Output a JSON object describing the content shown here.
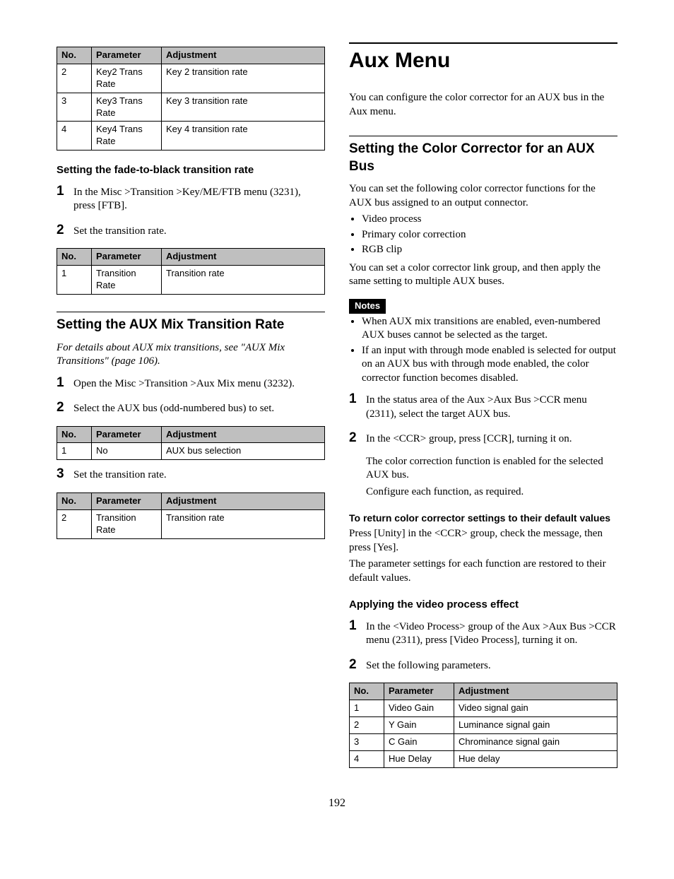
{
  "left": {
    "table1": {
      "headers": [
        "No.",
        "Parameter",
        "Adjustment"
      ],
      "rows": [
        {
          "no": "2",
          "param": "Key2 Trans Rate",
          "adj": "Key 2 transition rate"
        },
        {
          "no": "3",
          "param": "Key3 Trans Rate",
          "adj": "Key 3 transition rate"
        },
        {
          "no": "4",
          "param": "Key4 Trans Rate",
          "adj": "Key 4 transition rate"
        }
      ]
    },
    "h3_ftb": "Setting the fade-to-black transition rate",
    "ftb_step1": "In the Misc >Transition >Key/ME/FTB menu (3231), press [FTB].",
    "ftb_step2": "Set the transition rate.",
    "table2": {
      "headers": [
        "No.",
        "Parameter",
        "Adjustment"
      ],
      "rows": [
        {
          "no": "1",
          "param": "Transition Rate",
          "adj": "Transition rate"
        }
      ]
    },
    "h2_aux": "Setting the AUX Mix Transition Rate",
    "aux_note": "For details about AUX mix transitions, see \"AUX Mix Transitions\" (page 106).",
    "aux_step1": "Open the Misc >Transition >Aux Mix menu (3232).",
    "aux_step2": "Select the AUX bus (odd-numbered bus) to set.",
    "table3": {
      "headers": [
        "No.",
        "Parameter",
        "Adjustment"
      ],
      "rows": [
        {
          "no": "1",
          "param": "No",
          "adj": "AUX bus selection"
        }
      ]
    },
    "aux_step3": "Set the transition rate.",
    "table4": {
      "headers": [
        "No.",
        "Parameter",
        "Adjustment"
      ],
      "rows": [
        {
          "no": "2",
          "param": "Transition Rate",
          "adj": "Transition rate"
        }
      ]
    }
  },
  "right": {
    "h1": "Aux Menu",
    "intro": "You can configure the color corrector for an AUX bus in the Aux menu.",
    "h2_ccr": "Setting the Color Corrector for an AUX Bus",
    "ccr_intro": "You can set the following color corrector functions for the AUX bus assigned to an output connector.",
    "ccr_funcs": [
      "Video process",
      "Primary color correction",
      "RGB clip"
    ],
    "ccr_link": "You can set a color corrector link group, and then apply the same setting to multiple AUX buses.",
    "notes_label": "Notes",
    "notes": [
      "When AUX mix transitions are enabled, even-numbered AUX buses cannot be selected as the target.",
      "If an input with through mode enabled is selected for output on an AUX bus with through mode enabled, the color corrector function becomes disabled."
    ],
    "ccr_step1": "In the status area of the Aux >Aux Bus >CCR menu (2311), select the target AUX bus.",
    "ccr_step2": "In the <CCR> group, press [CCR], turning it on.",
    "ccr_step2a": "The color correction function is enabled for the selected AUX bus.",
    "ccr_step2b": "Configure each function, as required.",
    "h4_return": "To return color corrector settings to their default values",
    "return_p1": "Press [Unity] in the <CCR> group, check the message, then press [Yes].",
    "return_p2": "The parameter settings for each function are restored to their default values.",
    "h3_video": "Applying the video process effect",
    "vp_step1": "In the <Video Process> group of the Aux >Aux Bus >CCR menu (2311), press [Video Process], turning it on.",
    "vp_step2": "Set the following parameters.",
    "table5": {
      "headers": [
        "No.",
        "Parameter",
        "Adjustment"
      ],
      "rows": [
        {
          "no": "1",
          "param": "Video Gain",
          "adj": "Video signal gain"
        },
        {
          "no": "2",
          "param": "Y Gain",
          "adj": "Luminance signal gain"
        },
        {
          "no": "3",
          "param": "C Gain",
          "adj": "Chrominance signal gain"
        },
        {
          "no": "4",
          "param": "Hue Delay",
          "adj": "Hue delay"
        }
      ]
    }
  },
  "page_num": "192"
}
